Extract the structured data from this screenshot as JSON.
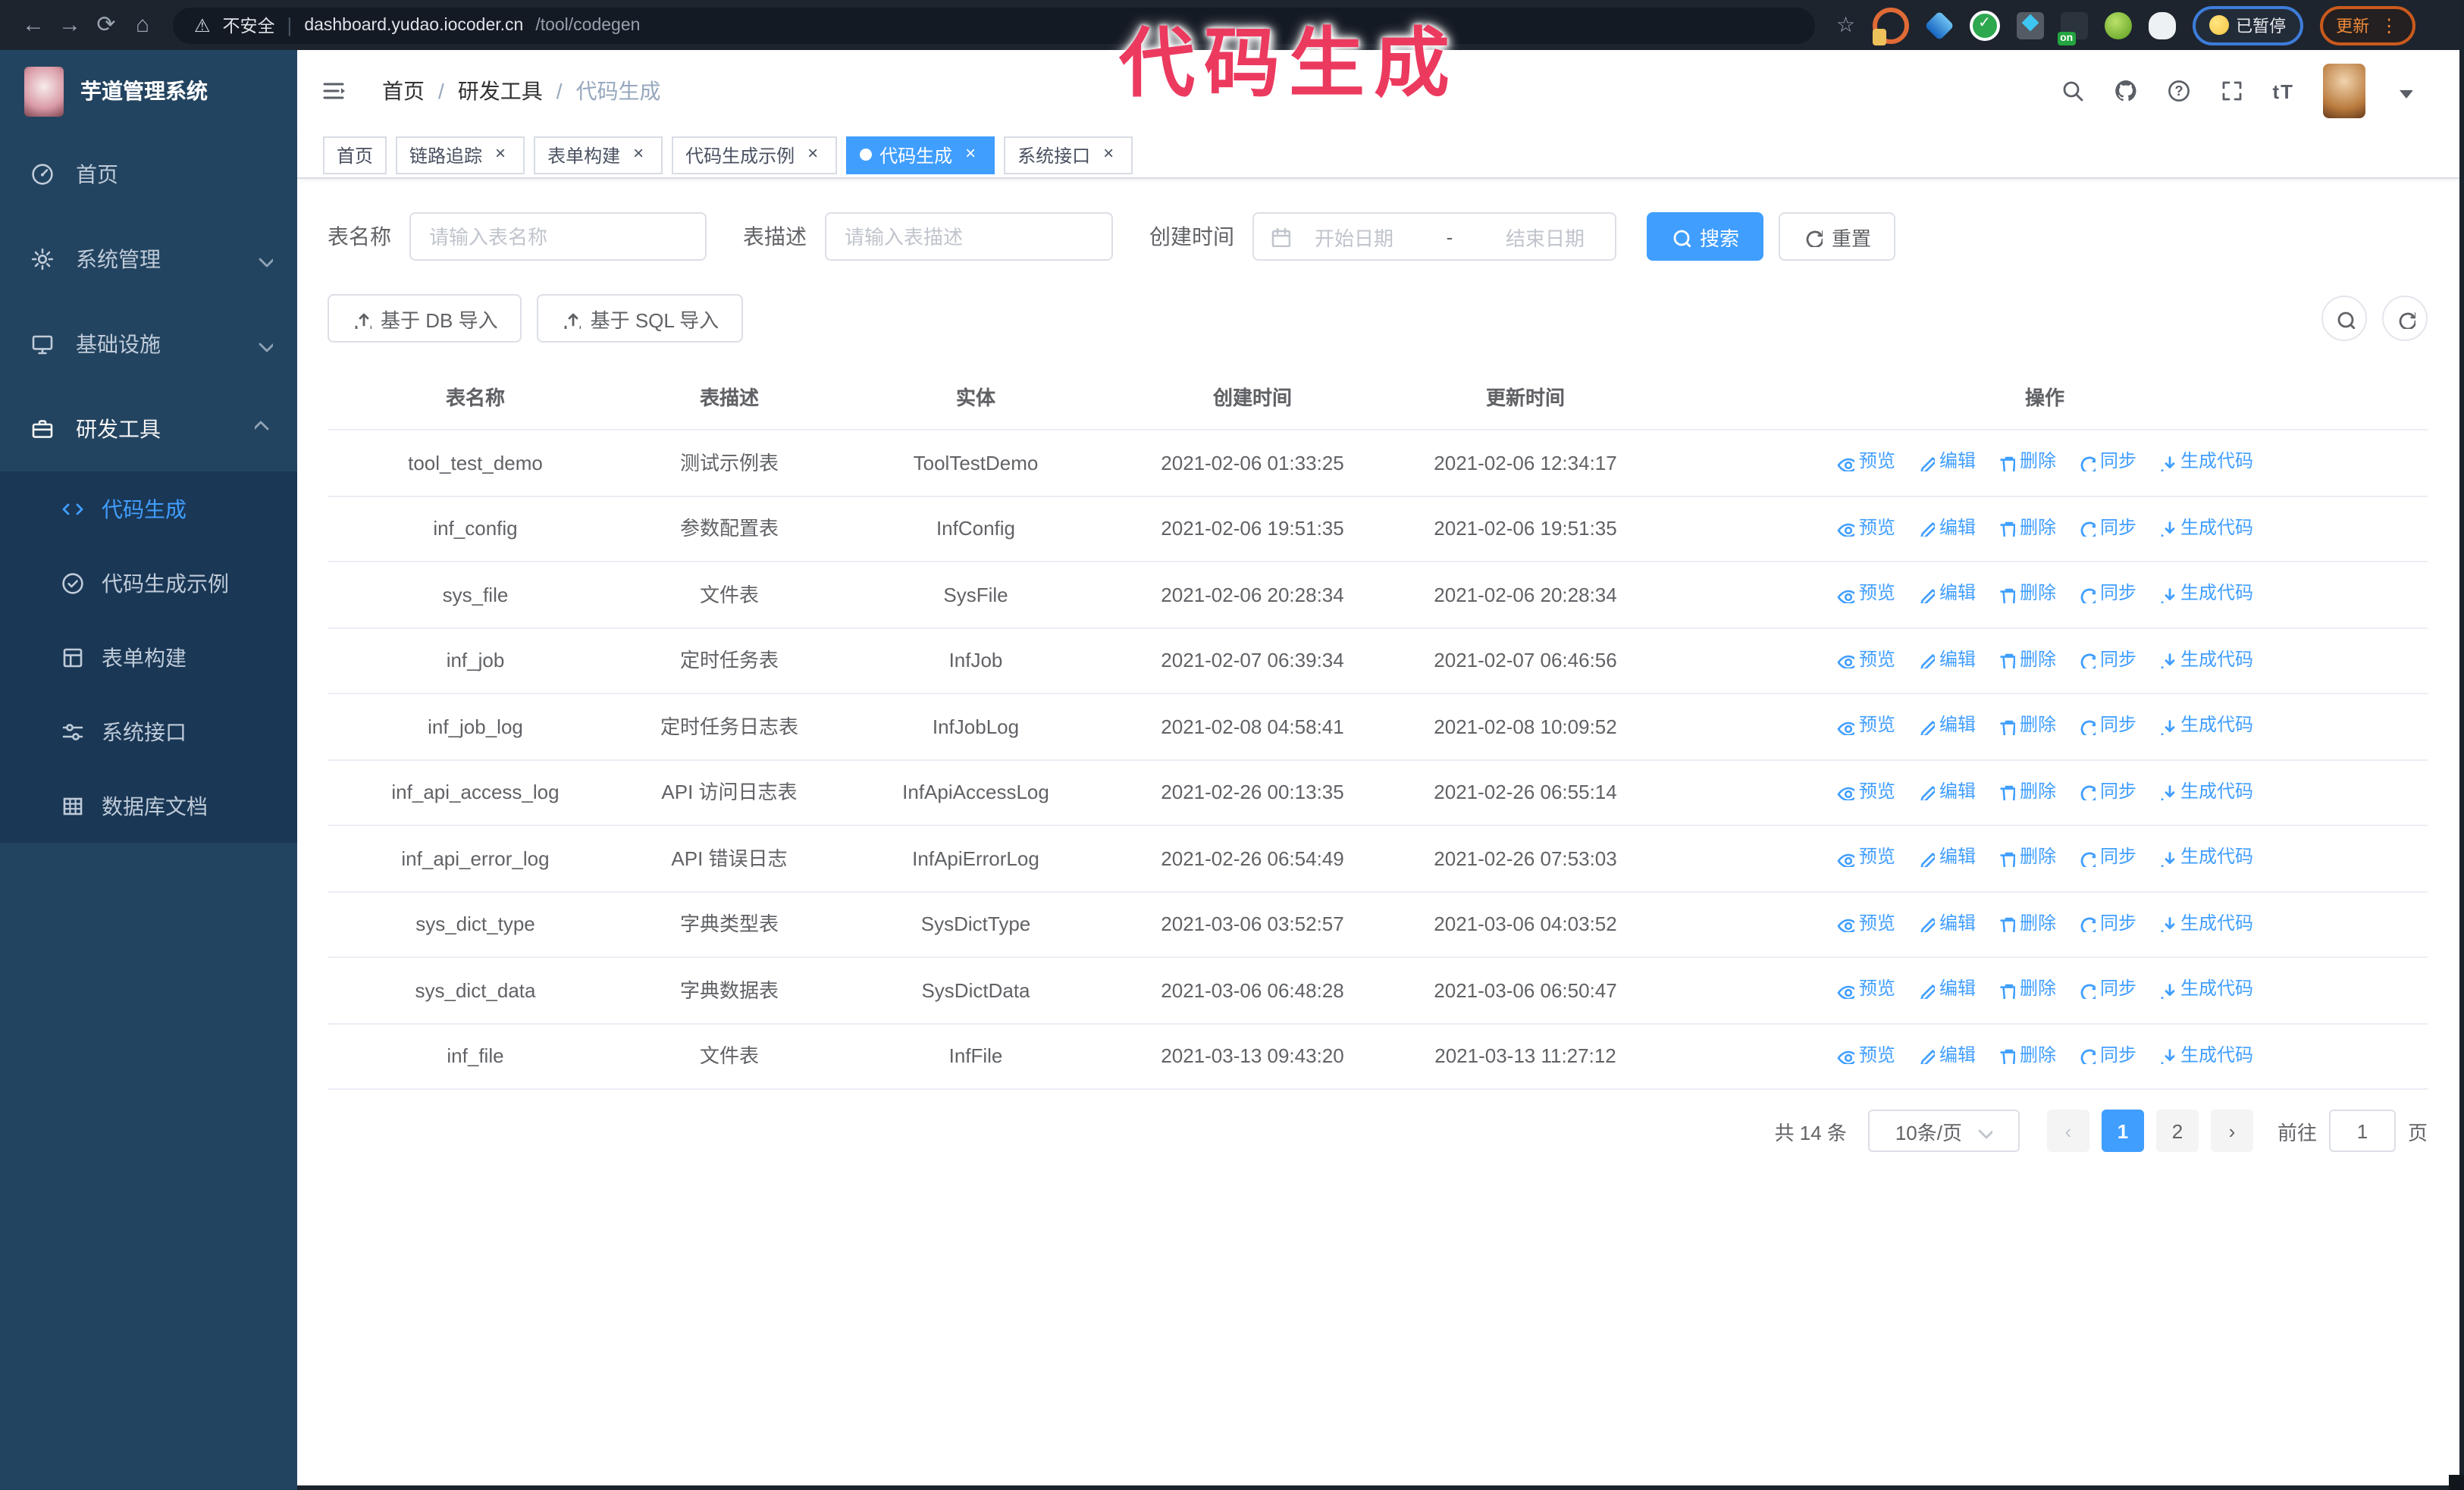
{
  "overlay": {
    "annotation": "代码生成"
  },
  "browser": {
    "nav_icons": [
      "back",
      "forward",
      "reload",
      "home"
    ],
    "security_label": "不安全",
    "url_host": "dashboard.yudao.iocoder.cn",
    "url_path": "/tool/codegen",
    "extension_on_badge": "on",
    "paused_badge": "已暂停",
    "update_button": "更新"
  },
  "sidebar": {
    "app_title": "芋道管理系统",
    "items": [
      {
        "label": "首页",
        "icon": "dashboard",
        "expandable": false,
        "expanded": false
      },
      {
        "label": "系统管理",
        "icon": "gear",
        "expandable": true,
        "expanded": false
      },
      {
        "label": "基础设施",
        "icon": "monitor",
        "expandable": true,
        "expanded": false
      },
      {
        "label": "研发工具",
        "icon": "toolbox",
        "expandable": true,
        "expanded": true
      }
    ],
    "submenu": [
      {
        "label": "代码生成",
        "icon": "code",
        "active": true
      },
      {
        "label": "代码生成示例",
        "icon": "example",
        "active": false
      },
      {
        "label": "表单构建",
        "icon": "form",
        "active": false
      },
      {
        "label": "系统接口",
        "icon": "api",
        "active": false
      },
      {
        "label": "数据库文档",
        "icon": "db",
        "active": false
      }
    ]
  },
  "header": {
    "breadcrumb": [
      "首页",
      "研发工具",
      "代码生成"
    ],
    "text_size_label": "tT",
    "right_icons": [
      "search",
      "github",
      "question",
      "fullscreen",
      "textsize",
      "avatar",
      "caret-down"
    ]
  },
  "tabs": [
    {
      "label": "首页",
      "closable": false,
      "active": false
    },
    {
      "label": "链路追踪",
      "closable": true,
      "active": false
    },
    {
      "label": "表单构建",
      "closable": true,
      "active": false
    },
    {
      "label": "代码生成示例",
      "closable": true,
      "active": false
    },
    {
      "label": "代码生成",
      "closable": true,
      "active": true
    },
    {
      "label": "系统接口",
      "closable": true,
      "active": false
    }
  ],
  "search": {
    "name_label": "表名称",
    "name_placeholder": "请输入表名称",
    "desc_label": "表描述",
    "desc_placeholder": "请输入表描述",
    "time_label": "创建时间",
    "start_placeholder": "开始日期",
    "range_separator": "-",
    "end_placeholder": "结束日期",
    "search_button": "搜索",
    "reset_button": "重置"
  },
  "toolbar": {
    "db_import": "基于 DB 导入",
    "sql_import": "基于 SQL 导入"
  },
  "table": {
    "columns": [
      "表名称",
      "表描述",
      "实体",
      "创建时间",
      "更新时间",
      "操作"
    ],
    "actions": [
      {
        "label": "预览",
        "icon": "eye"
      },
      {
        "label": "编辑",
        "icon": "edit"
      },
      {
        "label": "删除",
        "icon": "delete"
      },
      {
        "label": "同步",
        "icon": "sync"
      },
      {
        "label": "生成代码",
        "icon": "download"
      }
    ],
    "rows": [
      [
        "tool_test_demo",
        "测试示例表",
        "ToolTestDemo",
        "2021-02-06 01:33:25",
        "2021-02-06 12:34:17"
      ],
      [
        "inf_config",
        "参数配置表",
        "InfConfig",
        "2021-02-06 19:51:35",
        "2021-02-06 19:51:35"
      ],
      [
        "sys_file",
        "文件表",
        "SysFile",
        "2021-02-06 20:28:34",
        "2021-02-06 20:28:34"
      ],
      [
        "inf_job",
        "定时任务表",
        "InfJob",
        "2021-02-07 06:39:34",
        "2021-02-07 06:46:56"
      ],
      [
        "inf_job_log",
        "定时任务日志表",
        "InfJobLog",
        "2021-02-08 04:58:41",
        "2021-02-08 10:09:52"
      ],
      [
        "inf_api_access_log",
        "API 访问日志表",
        "InfApiAccessLog",
        "2021-02-26 00:13:35",
        "2021-02-26 06:55:14"
      ],
      [
        "inf_api_error_log",
        "API 错误日志",
        "InfApiErrorLog",
        "2021-02-26 06:54:49",
        "2021-02-26 07:53:03"
      ],
      [
        "sys_dict_type",
        "字典类型表",
        "SysDictType",
        "2021-03-06 03:52:57",
        "2021-03-06 04:03:52"
      ],
      [
        "sys_dict_data",
        "字典数据表",
        "SysDictData",
        "2021-03-06 06:48:28",
        "2021-03-06 06:50:47"
      ],
      [
        "inf_file",
        "文件表",
        "InfFile",
        "2021-03-13 09:43:20",
        "2021-03-13 11:27:12"
      ]
    ]
  },
  "pagination": {
    "total": "共 14 条",
    "page_size": "10条/页",
    "pages": [
      "1",
      "2"
    ],
    "active_page": "1",
    "prev_enabled": false,
    "next_enabled": true,
    "goto_label": "前往",
    "goto_value": "1",
    "page_label": "页"
  },
  "colors": {
    "primary": "#409eff",
    "sidebar": "#234460",
    "submenu": "#1a3755",
    "annotation": "#ec3a5f"
  }
}
